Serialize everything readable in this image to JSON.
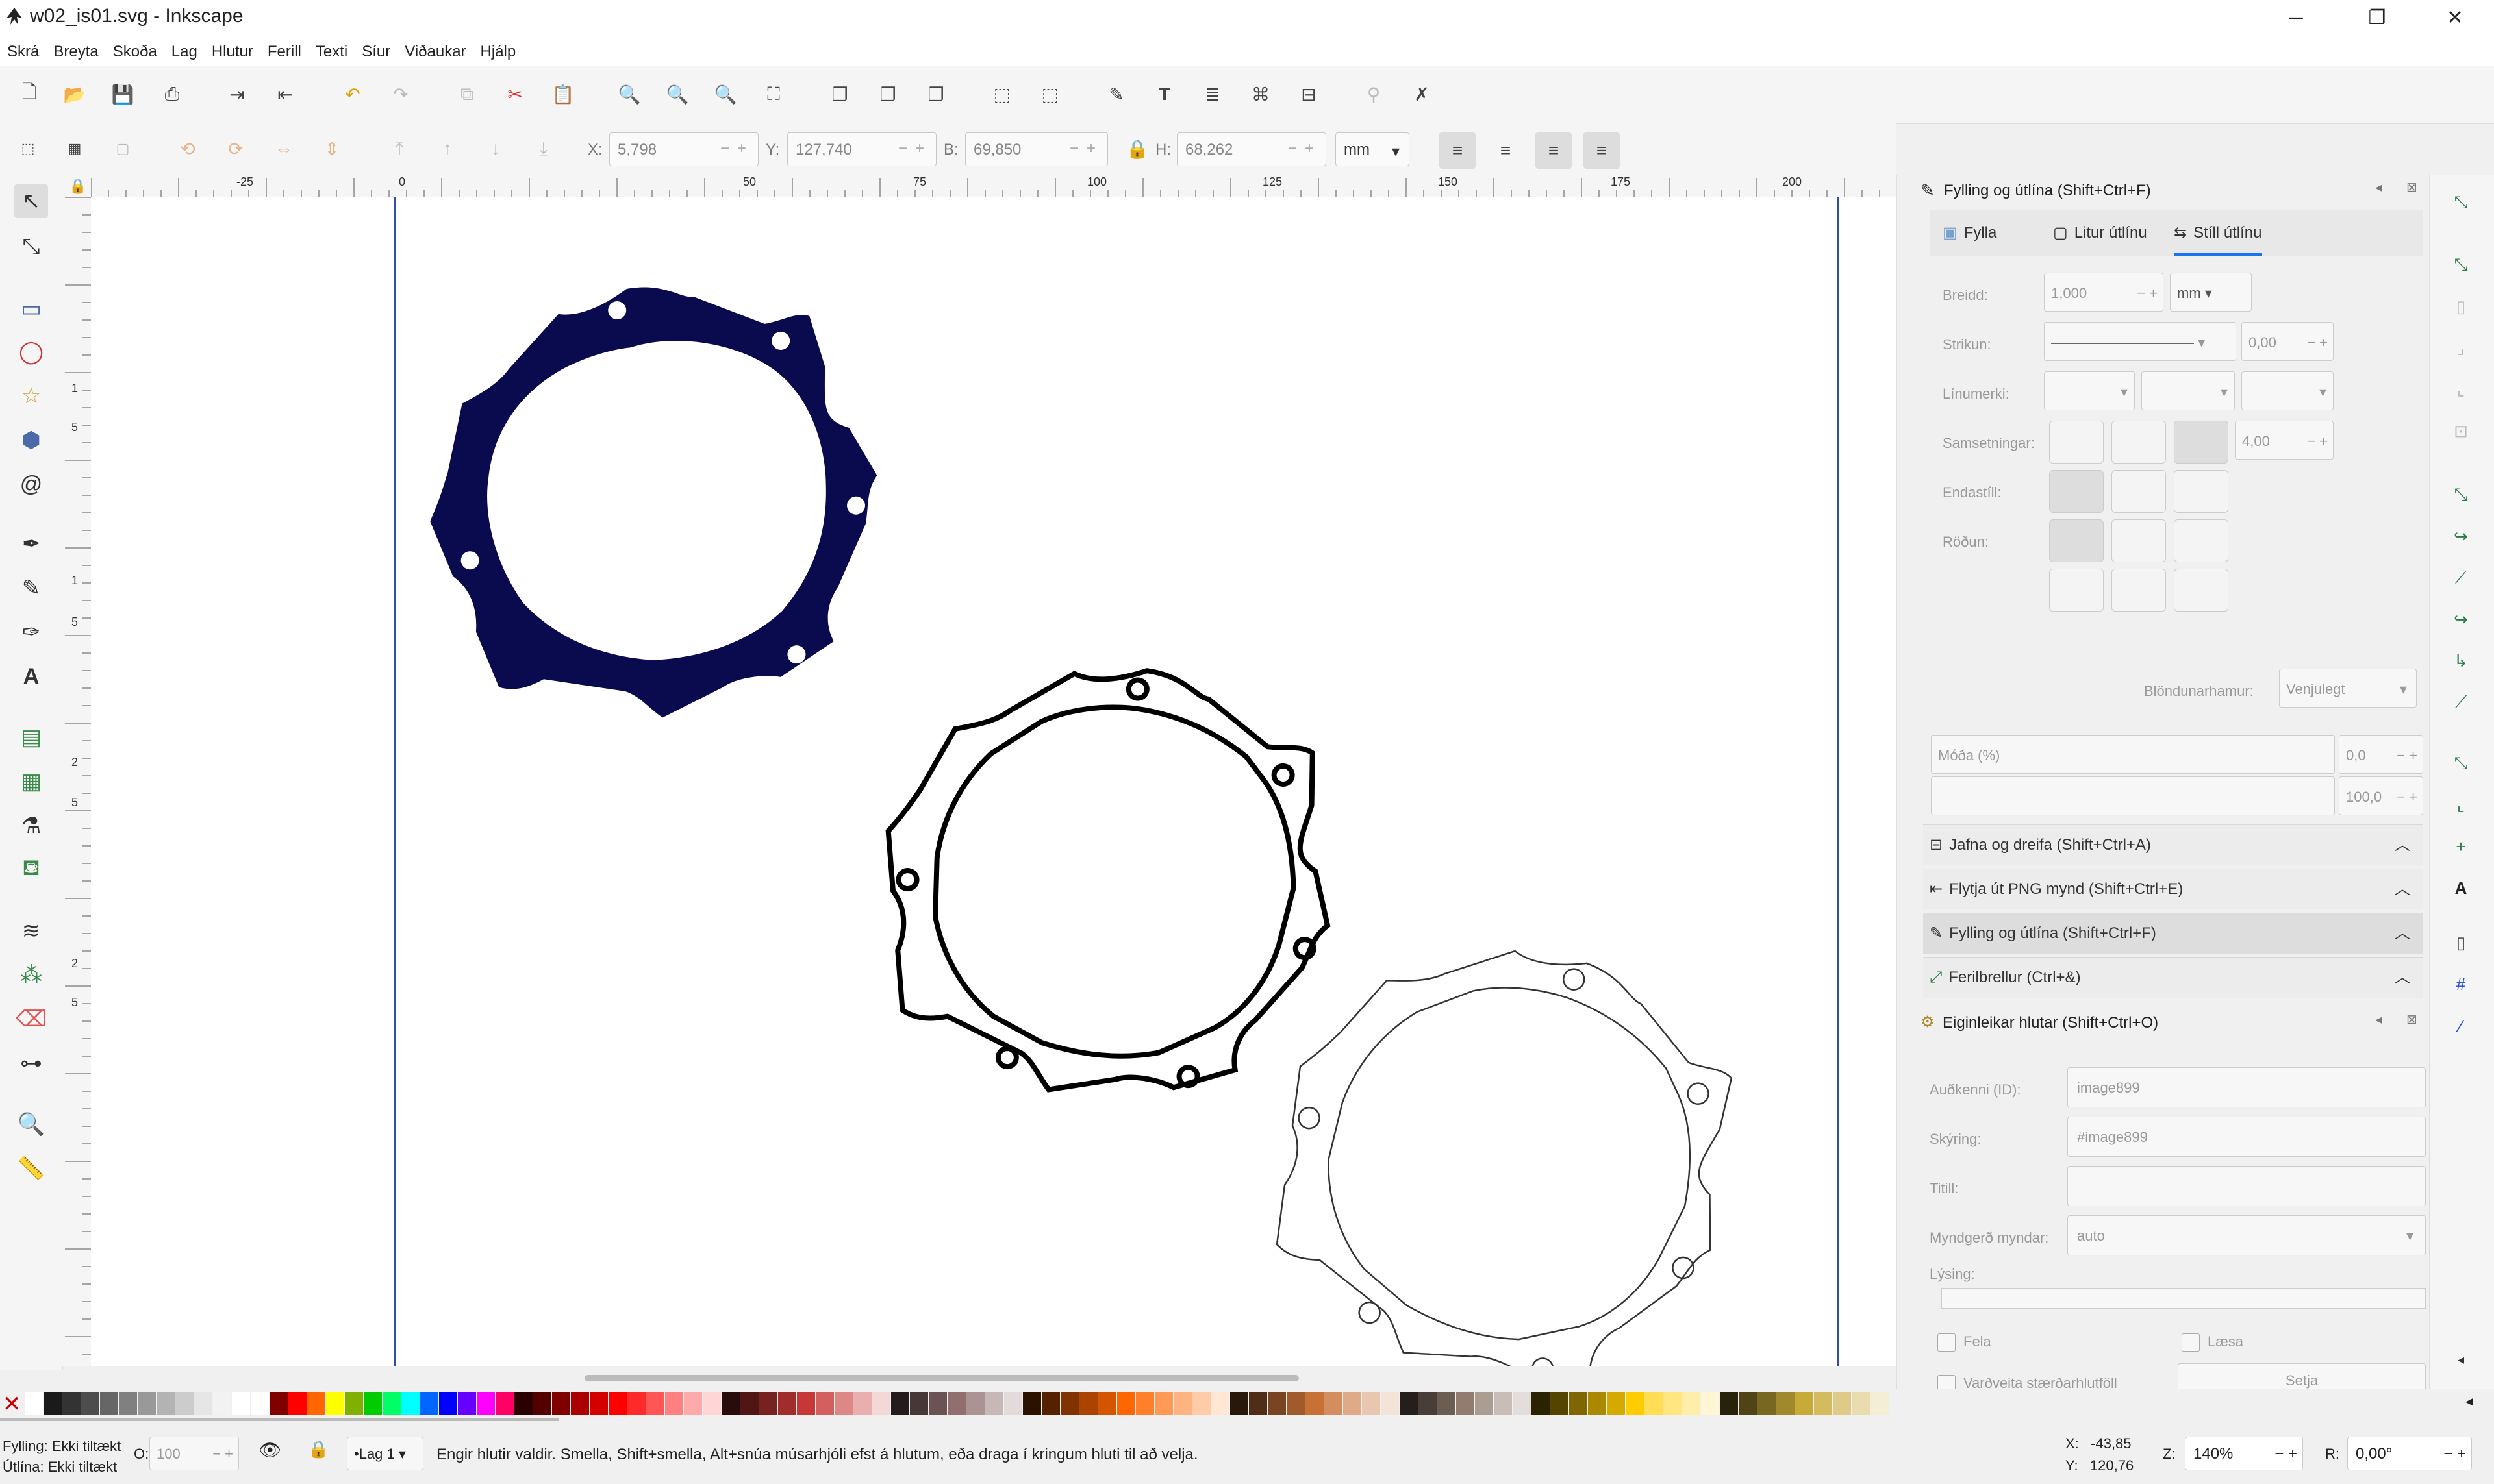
{
  "window": {
    "title": "w02_is01.svg - Inkscape",
    "minimize": "─",
    "maximize": "❐",
    "close": "✕"
  },
  "menu": [
    "Skrá",
    "Breyta",
    "Skoða",
    "Lag",
    "Hlutur",
    "Ferill",
    "Texti",
    "Síur",
    "Viðaukar",
    "Hjálp"
  ],
  "controls": {
    "x_label": "X:",
    "x_value": "5,798",
    "y_label": "Y:",
    "y_value": "127,740",
    "w_label": "B:",
    "w_value": "69,850",
    "h_label": "H:",
    "h_value": "68,262",
    "unit": "mm"
  },
  "ruler_labels": [
    "-25",
    "0",
    "50",
    "75",
    "100",
    "125",
    "150",
    "175",
    "200"
  ],
  "vruler_labels": [
    "1",
    "5",
    "1",
    "5",
    "2",
    "5",
    "2",
    "5"
  ],
  "fill_stroke": {
    "title": "Fylling og útlína (Shift+Ctrl+F)",
    "tabs": [
      "Fylla",
      "Litur útlínu",
      "Stíll útlínu"
    ],
    "width_label": "Breidd:",
    "width_value": "1,000",
    "width_unit": "mm",
    "dash_label": "Strikun:",
    "dash_value": "0,00",
    "markers_label": "Línumerki:",
    "join_label": "Samsetningar:",
    "join_value": "4,00",
    "cap_label": "Endastíll:",
    "order_label": "Röðun:",
    "blend_label": "Blöndunarhamur:",
    "blend_value": "Venjulegt",
    "blur_label": "Móða (%)",
    "blur_value": "0,0",
    "opacity_value": "100,0"
  },
  "panels": [
    "Jafna og dreifa (Shift+Ctrl+A)",
    "Flytja út PNG mynd (Shift+Ctrl+E)",
    "Fylling og útlína (Shift+Ctrl+F)",
    "Ferilbrellur  (Ctrl+&)"
  ],
  "object_props": {
    "title": "Eiginleikar hlutar (Shift+Ctrl+O)",
    "id_label": "Auðkenni (ID):",
    "id_value": "image899",
    "label_label": "Skýring:",
    "label_value": "#image899",
    "title_label": "Titill:",
    "title_value": "",
    "render_label": "Myndgerð myndar:",
    "render_value": "auto",
    "desc_label": "Lýsing:",
    "hide_label": "Fela",
    "lock_label": "Læsa",
    "preserve_label": "Varðveita stærðarhlutföll",
    "set_label": "Setja"
  },
  "status": {
    "fill_label": "Fylling:",
    "fill_value": "Ekki tiltækt",
    "stroke_label": "Útlína:",
    "stroke_value": "Ekki tiltækt",
    "opacity_label": "O:",
    "opacity_value": "100",
    "layer": "•Lag 1",
    "message": "Engir hlutir valdir. Smella, Shift+smella, Alt+snúa músarhjóli efst á hlutum, eða draga í kringum hluti til að velja.",
    "x_label": "X:",
    "x_value": "-43,85",
    "y_label": "Y:",
    "y_value": "120,76",
    "zoom_label": "Z:",
    "zoom_value": "140%",
    "rot_label": "R:",
    "rot_value": "0,00°"
  },
  "colors": {
    "accent": "#1a73e8",
    "navy_fill": "#0a0a4f",
    "snap_green": "#2a7a4a"
  }
}
